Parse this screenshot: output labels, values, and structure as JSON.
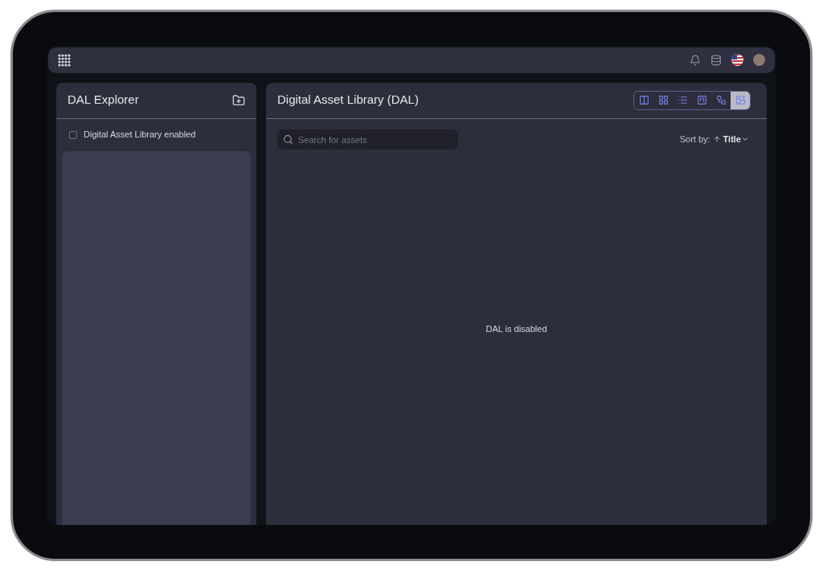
{
  "sidebar": {
    "title": "DAL Explorer",
    "checkbox": {
      "label": "Digital Asset Library enabled",
      "checked": false
    }
  },
  "main": {
    "title": "Digital Asset Library (DAL)",
    "views": [
      {
        "kind": "columns",
        "selected": false
      },
      {
        "kind": "grid",
        "selected": false
      },
      {
        "kind": "list",
        "selected": false
      },
      {
        "kind": "board",
        "selected": false
      },
      {
        "kind": "graph",
        "selected": false
      },
      {
        "kind": "image",
        "selected": true
      }
    ],
    "search": {
      "placeholder": "Search for assets"
    },
    "sort": {
      "label": "Sort by:",
      "value": "Title"
    },
    "empty_message": "DAL is disabled"
  }
}
